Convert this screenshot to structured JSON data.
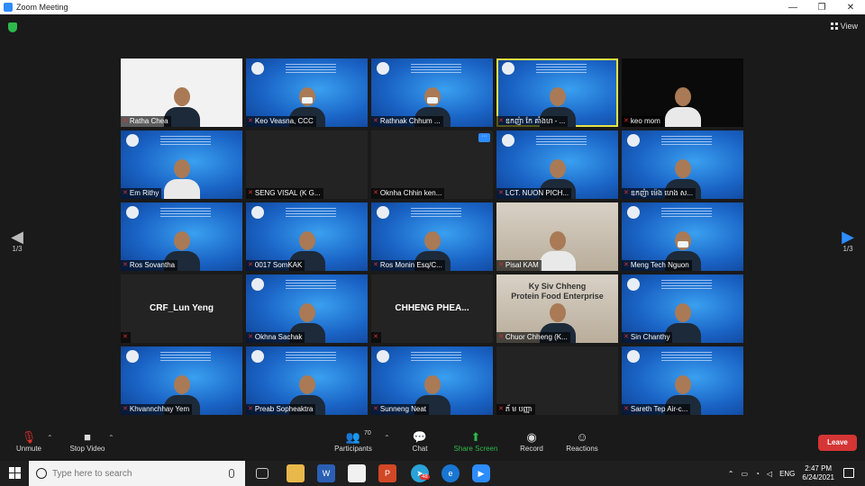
{
  "window": {
    "title": "Zoom Meeting",
    "controls": [
      "—",
      "❐",
      "✕"
    ]
  },
  "view": {
    "label": "View"
  },
  "pager": {
    "left": "1/3",
    "right": "1/3",
    "left_arrow": "◀",
    "right_arrow": "▶"
  },
  "tiles": [
    {
      "name": "Ratha Chea",
      "style": "white"
    },
    {
      "name": "Keo Veasna, CCC",
      "style": "blue",
      "person": "mask"
    },
    {
      "name": "Rathnak Chhum ...",
      "style": "blue",
      "person": "mask"
    },
    {
      "name": "ឧកញ៉ា កែ គាំងហ - ...",
      "style": "blue",
      "active": true
    },
    {
      "name": "keo mom",
      "style": "black",
      "person": "light"
    },
    {
      "name": "Em Rithy",
      "style": "blue",
      "person": "light"
    },
    {
      "name": "SENG VISAL (K G...",
      "style": "dark"
    },
    {
      "name": "Oknha Chhin ken...",
      "style": "dark",
      "more": "···"
    },
    {
      "name": "LCT. NUON PICH...",
      "style": "blue"
    },
    {
      "name": "ឧកញ៉ា ម៉េង ហេង ស...",
      "style": "blue"
    },
    {
      "name": "Ros Sovantha",
      "style": "blue"
    },
    {
      "name": "0017 SomKAK",
      "style": "blue"
    },
    {
      "name": "Ros Monin Esq/C...",
      "style": "blue"
    },
    {
      "name": "Pisal KAM",
      "style": "room",
      "person": "light"
    },
    {
      "name": "Meng Tech Nguon",
      "style": "blue",
      "person": "mask"
    },
    {
      "name": "",
      "style": "dark",
      "big": "CRF_Lun Yeng"
    },
    {
      "name": "Okhna Sachak",
      "style": "blue"
    },
    {
      "name": "",
      "style": "dark",
      "big": "CHHENG  PHEA..."
    },
    {
      "name": "Chuor Chheng (K...",
      "style": "room",
      "sign": "Ky Siv Chheng\nProtein Food Enterprise"
    },
    {
      "name": "Sin Chanthy",
      "style": "blue"
    },
    {
      "name": "Khvannchhay Yem",
      "style": "blue"
    },
    {
      "name": "Preab Sopheaktra",
      "style": "blue"
    },
    {
      "name": "Sunneng Neat",
      "style": "blue"
    },
    {
      "name": "ភ័ ម បញ្ញា",
      "style": "dark"
    },
    {
      "name": "Sareth Tep Air-c...",
      "style": "blue"
    }
  ],
  "toolbar": {
    "unmute": "Unmute",
    "stop_video": "Stop Video",
    "participants": "Participants",
    "participants_count": "70",
    "chat": "Chat",
    "share_screen": "Share Screen",
    "record": "Record",
    "reactions": "Reactions",
    "leave": "Leave"
  },
  "taskbar": {
    "search_placeholder": "Type here to search",
    "lang": "ENG",
    "time": "2:47 PM",
    "date": "6/24/2021",
    "telegram_badge": "48"
  }
}
